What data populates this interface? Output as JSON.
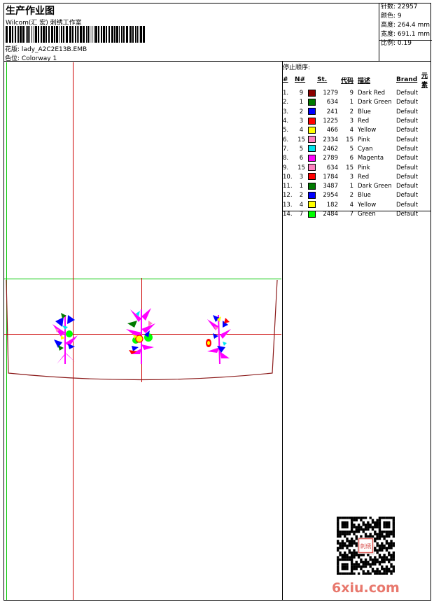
{
  "header": {
    "title": "生产作业图",
    "company": "Wilcom(汇 宏) 刺绣工作室",
    "file_label": "花版:",
    "file_name": "lady_A2C2E13B.EMB",
    "colorway_label": "色位:",
    "colorway_name": "Colorway 1"
  },
  "stats": {
    "stitches": "针数: 22957",
    "colors": "颜色: 9",
    "height": "高度: 264.4 mm",
    "width": "宽度: 691.1 mm",
    "scale": "比例: 0.19"
  },
  "sequence": {
    "title": "停止顺序:",
    "headers": {
      "idx": "#",
      "n": "N#",
      "st": "St.",
      "code": "代码",
      "desc": "描述",
      "brand": "Brand",
      "elem": "元素"
    },
    "rows": [
      {
        "idx": "1.",
        "n": "9",
        "color": "#8b0000",
        "st": "1279",
        "code": "9",
        "desc": "Dark Red",
        "brand": "Default"
      },
      {
        "idx": "2.",
        "n": "1",
        "color": "#007a00",
        "st": "634",
        "code": "1",
        "desc": "Dark Green",
        "brand": "Default"
      },
      {
        "idx": "3.",
        "n": "2",
        "color": "#0000ff",
        "st": "241",
        "code": "2",
        "desc": "Blue",
        "brand": "Default"
      },
      {
        "idx": "4.",
        "n": "3",
        "color": "#ff0000",
        "st": "1225",
        "code": "3",
        "desc": "Red",
        "brand": "Default"
      },
      {
        "idx": "5.",
        "n": "4",
        "color": "#ffff00",
        "st": "466",
        "code": "4",
        "desc": "Yellow",
        "brand": "Default"
      },
      {
        "idx": "6.",
        "n": "15",
        "color": "#ff80c0",
        "st": "2334",
        "code": "15",
        "desc": "Pink",
        "brand": "Default"
      },
      {
        "idx": "7.",
        "n": "5",
        "color": "#00e5ee",
        "st": "2462",
        "code": "5",
        "desc": "Cyan",
        "brand": "Default"
      },
      {
        "idx": "8.",
        "n": "6",
        "color": "#ff00ff",
        "st": "2789",
        "code": "6",
        "desc": "Magenta",
        "brand": "Default"
      },
      {
        "idx": "9.",
        "n": "15",
        "color": "#ff80c0",
        "st": "634",
        "code": "15",
        "desc": "Pink",
        "brand": "Default"
      },
      {
        "idx": "10.",
        "n": "3",
        "color": "#ff0000",
        "st": "1784",
        "code": "3",
        "desc": "Red",
        "brand": "Default"
      },
      {
        "idx": "11.",
        "n": "1",
        "color": "#007a00",
        "st": "3487",
        "code": "1",
        "desc": "Dark Green",
        "brand": "Default"
      },
      {
        "idx": "12.",
        "n": "2",
        "color": "#0000ff",
        "st": "2954",
        "code": "2",
        "desc": "Blue",
        "brand": "Default"
      },
      {
        "idx": "13.",
        "n": "4",
        "color": "#ffff00",
        "st": "182",
        "code": "4",
        "desc": "Yellow",
        "brand": "Default"
      },
      {
        "idx": "14.",
        "n": "7",
        "color": "#00ff00",
        "st": "2484",
        "code": "7",
        "desc": "Green",
        "brand": "Default"
      }
    ]
  },
  "watermark": "6xiu.com",
  "qr_stamp_text": "刺绣",
  "colors": {
    "guide_red": "#cc0000",
    "guide_green": "#00c800",
    "outline": "#8b1a1a",
    "watermark": "#e8786d"
  }
}
